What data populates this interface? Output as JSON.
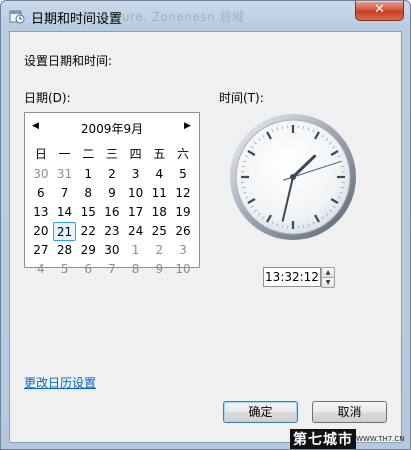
{
  "window": {
    "title": "日期和时间设置",
    "title_ghost": "...ure. Zonenesn 局域",
    "close_label": "✕"
  },
  "heading": "设置日期和时间:",
  "date_label": "日期(D):",
  "time_label": "时间(T):",
  "calendar": {
    "month_title": "2009年9月",
    "prev_arrow": "◀",
    "next_arrow": "▶",
    "weekdays": [
      "日",
      "一",
      "二",
      "三",
      "四",
      "五",
      "六"
    ],
    "weeks": [
      [
        {
          "d": "30",
          "dim": true
        },
        {
          "d": "31",
          "dim": true
        },
        {
          "d": "1"
        },
        {
          "d": "2"
        },
        {
          "d": "3"
        },
        {
          "d": "4"
        },
        {
          "d": "5"
        }
      ],
      [
        {
          "d": "6"
        },
        {
          "d": "7"
        },
        {
          "d": "8"
        },
        {
          "d": "9"
        },
        {
          "d": "10"
        },
        {
          "d": "11"
        },
        {
          "d": "12"
        }
      ],
      [
        {
          "d": "13"
        },
        {
          "d": "14"
        },
        {
          "d": "15"
        },
        {
          "d": "16"
        },
        {
          "d": "17"
        },
        {
          "d": "18"
        },
        {
          "d": "19"
        }
      ],
      [
        {
          "d": "20"
        },
        {
          "d": "21",
          "sel": true
        },
        {
          "d": "22"
        },
        {
          "d": "23"
        },
        {
          "d": "24"
        },
        {
          "d": "25"
        },
        {
          "d": "26"
        }
      ],
      [
        {
          "d": "27"
        },
        {
          "d": "28"
        },
        {
          "d": "29"
        },
        {
          "d": "30"
        },
        {
          "d": "1",
          "dim": true
        },
        {
          "d": "2",
          "dim": true
        },
        {
          "d": "3",
          "dim": true
        }
      ],
      [
        {
          "d": "4",
          "dim": true
        },
        {
          "d": "5",
          "dim": true
        },
        {
          "d": "6",
          "dim": true
        },
        {
          "d": "7",
          "dim": true
        },
        {
          "d": "8",
          "dim": true
        },
        {
          "d": "9",
          "dim": true
        },
        {
          "d": "10",
          "dim": true
        }
      ]
    ]
  },
  "clock": {
    "hours": 13,
    "minutes": 32,
    "seconds": 12
  },
  "time_value": "13:32:12",
  "spinner": {
    "up": "▲",
    "down": "▼"
  },
  "change_calendar_link": "更改日历设置",
  "buttons": {
    "ok": "确定",
    "cancel": "取消"
  },
  "watermark": {
    "text": "第七城市",
    "url": "WWW.TH7.CN"
  },
  "colors": {
    "link": "#0066cc",
    "selected_day_border": "#3399ff",
    "second_hand": "#2d5f88"
  }
}
